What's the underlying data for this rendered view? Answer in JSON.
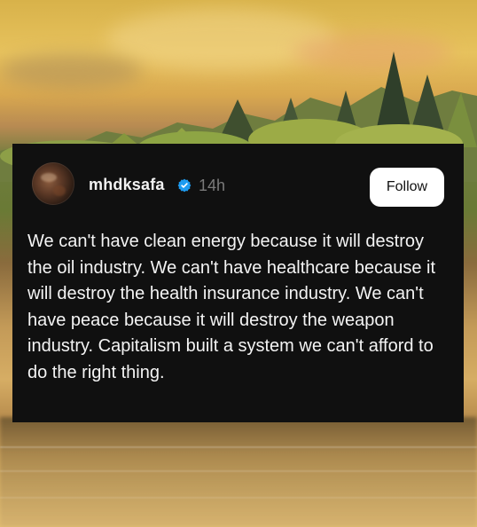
{
  "background": {
    "type": "sunset-lake-forest",
    "sky_color": "#d8b24a",
    "forest_color": "#6a7a35",
    "water_color": "#d6ad64"
  },
  "post": {
    "username": "mhdksafa",
    "verified_icon": "verified-badge-icon",
    "time": "14h",
    "follow_label": "Follow",
    "text": "We can't have clean energy because it will destroy the oil industry. We can't have healthcare because it will destroy the health insurance industry. We can't have peace because it will destroy the weapon industry. Capitalism built a system we can't afford to do the right thing."
  },
  "colors": {
    "card_bg": "#101010",
    "text": "#f4f4f4",
    "muted": "#7a7a7a",
    "verified_blue": "#1d9bf0",
    "button_bg": "#ffffff"
  }
}
